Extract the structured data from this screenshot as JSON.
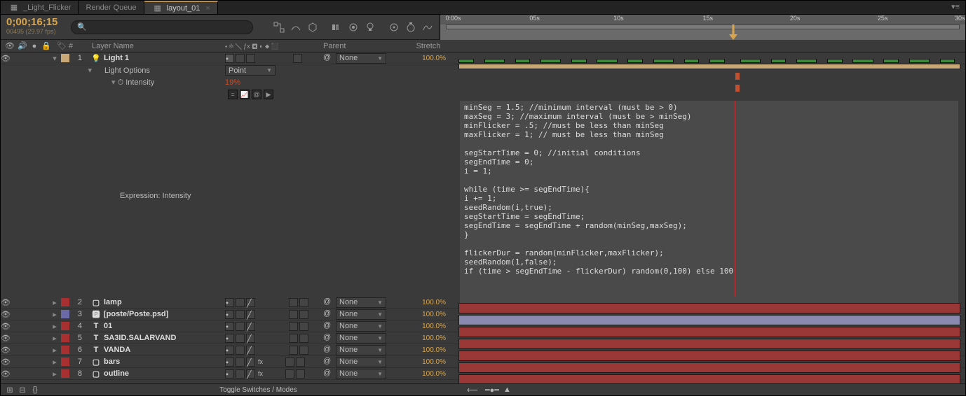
{
  "tabs": [
    {
      "label": "_Light_Flicker",
      "active": false
    },
    {
      "label": "Render Queue",
      "active": false
    },
    {
      "label": "layout_01",
      "active": true
    }
  ],
  "timecode": "0;00;16;15",
  "frames_label": "00495 (29.97 fps)",
  "search_placeholder": "",
  "columns": {
    "idx": "#",
    "name": "Layer Name",
    "parent": "Parent",
    "stretch": "Stretch"
  },
  "ruler_ticks": [
    "0:00s",
    "05s",
    "10s",
    "15s",
    "20s",
    "25s",
    "30s"
  ],
  "playhead_pct": 55.0,
  "layers": [
    {
      "idx": 1,
      "color": "#c9a878",
      "name": "Light 1",
      "icon": "light",
      "bold": true,
      "parent": "None",
      "stretch": "100.0%",
      "sel": true,
      "bar_color": "#c9a878"
    },
    {
      "idx": 2,
      "color": "#a83030",
      "name": "lamp",
      "icon": "solid",
      "bold": true,
      "parent": "None",
      "stretch": "100.0%",
      "bar_color": "#9a3838"
    },
    {
      "idx": 3,
      "color": "#6a6aa8",
      "name": "[poste/Poste.psd]",
      "icon": "ps",
      "bold": true,
      "bracket": true,
      "parent": "None",
      "stretch": "100.0%",
      "bar_color": "#8a8ab0"
    },
    {
      "idx": 4,
      "color": "#a83030",
      "name": "01",
      "icon": "text",
      "bold": true,
      "parent": "None",
      "stretch": "100.0%",
      "bar_color": "#9a3838"
    },
    {
      "idx": 5,
      "color": "#a83030",
      "name": "SA3ID.SALARVAND",
      "icon": "text",
      "bold": true,
      "parent": "None",
      "stretch": "100.0%",
      "bar_color": "#9a3838"
    },
    {
      "idx": 6,
      "color": "#a83030",
      "name": "VANDA",
      "icon": "text",
      "bold": true,
      "parent": "None",
      "stretch": "100.0%",
      "bar_color": "#9a3838"
    },
    {
      "idx": 7,
      "color": "#a83030",
      "name": "bars",
      "icon": "solid",
      "bold": true,
      "fx": true,
      "parent": "None",
      "stretch": "100.0%",
      "bar_color": "#9a3838"
    },
    {
      "idx": 8,
      "color": "#a83030",
      "name": "outline",
      "icon": "solid",
      "bold": true,
      "fx": true,
      "parent": "None",
      "stretch": "100.0%",
      "bar_color": "#9a3838"
    }
  ],
  "light_options": {
    "label": "Light Options",
    "type_label": "Point",
    "intensity_label": "Intensity",
    "intensity_value": "19%",
    "expression_label": "Expression: Intensity"
  },
  "expression_code": "minSeg = 1.5; //minimum interval (must be > 0)\nmaxSeg = 3; //maximum interval (must be > minSeg)\nminFlicker = .5; //must be less than minSeg\nmaxFlicker = 1; // must be less than minSeg\n\nsegStartTime = 0; //initial conditions\nsegEndTime = 0;\ni = 1;\n\nwhile (time >= segEndTime){\ni += 1;\nseedRandom(i,true);\nsegStartTime = segEndTime;\nsegEndTime = segEndTime + random(minSeg,maxSeg);\n}\n\nflickerDur = random(minFlicker,maxFlicker);\nseedRandom(1,false);\nif (time > segEndTime - flickerDur) random(0,100) else 100",
  "footer_label": "Toggle Switches / Modes",
  "parent_none": "None"
}
